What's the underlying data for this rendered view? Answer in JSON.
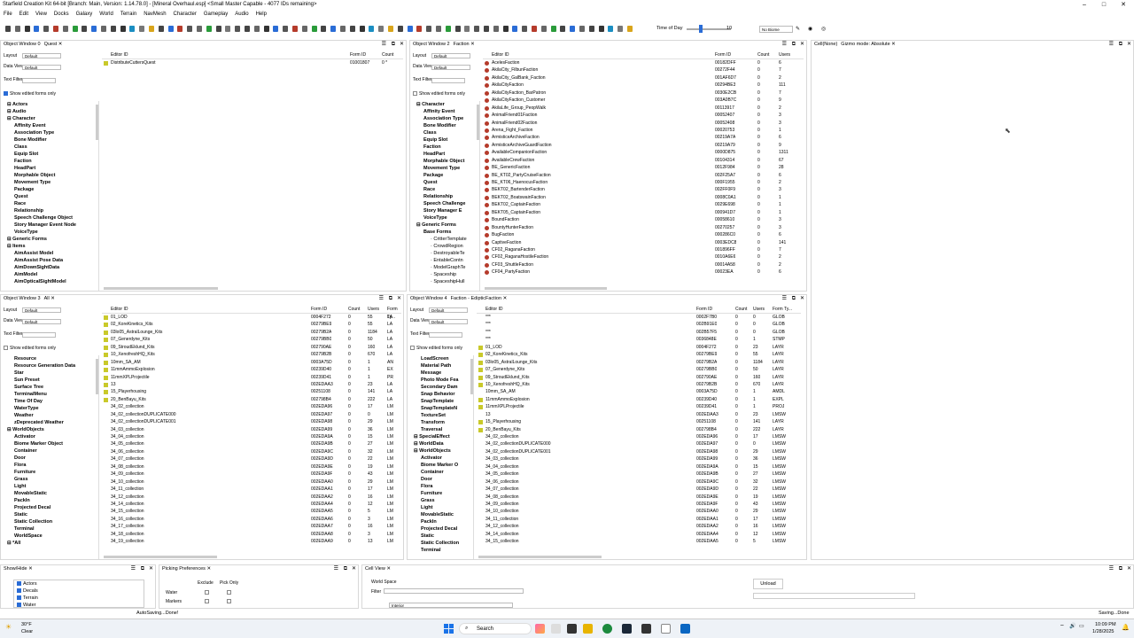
{
  "app": {
    "title": "Starfield Creation Kit 64-bit [Branch: Main, Version: 1.14.78.0] - [Mineral Overhaul.esp] <Small Master Capable - 4077 IDs remaining>"
  },
  "menu": [
    "File",
    "Edit",
    "View",
    "Docks",
    "Galaxy",
    "World",
    "Terrain",
    "NavMesh",
    "Character",
    "Gameplay",
    "Audio",
    "Help"
  ],
  "toolbar": {
    "time_label": "Time of Day",
    "time_value": "10",
    "biome": "No Biome"
  },
  "cell_window": {
    "title": "Cell(None)",
    "gizmo": "Gizmo mode: Absolute"
  },
  "common": {
    "layout": "Layout",
    "data_view": "Data View",
    "text_filter": "Text Filter",
    "default": "Default",
    "show_edited": "Show edited forms only",
    "editor_id": "Editor ID",
    "form_id": "Form ID",
    "count": "Count",
    "users": "Users",
    "form_type": "Form Ty..."
  },
  "ow0": {
    "title": "Object Window 0",
    "tab": "Quest",
    "tree": [
      [
        "Actors",
        0,
        1
      ],
      [
        "Audio",
        0,
        1
      ],
      [
        "Character",
        0,
        1
      ],
      [
        "Affinity Event",
        1,
        1
      ],
      [
        "Association Type",
        1,
        1
      ],
      [
        "Bone Modifier",
        1,
        1
      ],
      [
        "Class",
        1,
        1
      ],
      [
        "Equip Slot",
        1,
        1
      ],
      [
        "Faction",
        1,
        1
      ],
      [
        "HeadPart",
        1,
        1
      ],
      [
        "Morphable Object",
        1,
        1
      ],
      [
        "Movement Type",
        1,
        1
      ],
      [
        "Package",
        1,
        1
      ],
      [
        "Quest",
        1,
        1
      ],
      [
        "Race",
        1,
        1
      ],
      [
        "Relationship",
        1,
        1
      ],
      [
        "Speech Challenge Object",
        1,
        1
      ],
      [
        "Story Manager Event Node",
        1,
        1
      ],
      [
        "VoiceType",
        1,
        1
      ],
      [
        "Generic Forms",
        0,
        1
      ],
      [
        "Items",
        0,
        1
      ],
      [
        "AimAssist Model",
        1,
        1
      ],
      [
        "AimAssist Pose Data",
        1,
        1
      ],
      [
        "AimDownSightData",
        1,
        1
      ],
      [
        "AimModel",
        1,
        1
      ],
      [
        "AimOpticalSightModel",
        1,
        1
      ]
    ],
    "rows": [
      [
        "DistributeCuttersQuest",
        "01001807",
        "0 *"
      ]
    ]
  },
  "ow2": {
    "title": "Object Window 2",
    "tab": "Faction",
    "tree": [
      [
        "Character",
        0,
        1
      ],
      [
        "Affinity Event",
        1,
        1
      ],
      [
        "Association Type",
        1,
        1
      ],
      [
        "Bone Modifier",
        1,
        1
      ],
      [
        "Class",
        1,
        1
      ],
      [
        "Equip Slot",
        1,
        1
      ],
      [
        "Faction",
        1,
        1
      ],
      [
        "HeadPart",
        1,
        1
      ],
      [
        "Morphable Object",
        1,
        1
      ],
      [
        "Movement Type",
        1,
        1
      ],
      [
        "Package",
        1,
        1
      ],
      [
        "Quest",
        1,
        1
      ],
      [
        "Race",
        1,
        1
      ],
      [
        "Relationship",
        1,
        1
      ],
      [
        "Speech Challenge",
        1,
        1
      ],
      [
        "Story Manager E",
        1,
        1
      ],
      [
        "VoiceType",
        1,
        1
      ],
      [
        "Generic Forms",
        0,
        1
      ],
      [
        "Base Forms",
        1,
        1
      ],
      [
        "CritterTemplate",
        2,
        0
      ],
      [
        "CrowdRegion",
        2,
        0
      ],
      [
        "DestroyableTe",
        2,
        0
      ],
      [
        "EntableContn",
        2,
        0
      ],
      [
        "ModelGraphTe",
        2,
        0
      ],
      [
        "Spaceship",
        2,
        0
      ],
      [
        "SpaceshipHull",
        2,
        0
      ]
    ],
    "rows": [
      [
        "AcelesFaction",
        "00182DFF",
        "0",
        "6"
      ],
      [
        "AkilaCity_FilbunFaction",
        "00272F44",
        "0",
        "7"
      ],
      [
        "AkilaCity_GalBank_Faction",
        "001AF6D7",
        "0",
        "2"
      ],
      [
        "AkilaCityFaction",
        "00294BE3",
        "0",
        "111"
      ],
      [
        "AkilaCityFaction_BarPatron",
        "0030E2CB",
        "0",
        "7"
      ],
      [
        "AkilaCityFaction_Customer",
        "003A0B7C",
        "0",
        "9"
      ],
      [
        "AkilaLife_Group_PeopWalk",
        "00113917",
        "0",
        "2"
      ],
      [
        "AnimalFriend01Faction",
        "00052407",
        "0",
        "3"
      ],
      [
        "AnimalFriend02Faction",
        "00052408",
        "0",
        "3"
      ],
      [
        "Arena_Fight_Faction",
        "00020753",
        "0",
        "1"
      ],
      [
        "ArmisticeArchiveFaction",
        "00219A7A",
        "0",
        "6"
      ],
      [
        "ArmisticeArchiveGuardFaction",
        "00219A79",
        "0",
        "9"
      ],
      [
        "AvailableCompanionFaction",
        "0000D875",
        "0",
        "1311"
      ],
      [
        "AvailableCrewFaction",
        "00104314",
        "0",
        "67"
      ],
      [
        "BE_GenericFaction",
        "0012F984",
        "0",
        "28"
      ],
      [
        "BE_KT02_PartyCruiseFaction",
        "002F25A7",
        "0",
        "6"
      ],
      [
        "BE_KT06_HaenocusFaction",
        "000F1955",
        "0",
        "2"
      ],
      [
        "BEKT02_BartenderFaction",
        "002FF0F9",
        "0",
        "3"
      ],
      [
        "BEKT02_BoatswainFaction",
        "0008C0A1",
        "0",
        "1"
      ],
      [
        "BEKT02_CaptainFaction",
        "0029E698",
        "0",
        "1"
      ],
      [
        "BEKT05_CaptainFaction",
        "000941D7",
        "0",
        "1"
      ],
      [
        "BoundFaction",
        "00058610",
        "0",
        "3"
      ],
      [
        "BountyHunterFaction",
        "00270257",
        "0",
        "3"
      ],
      [
        "BugFaction",
        "000286C0",
        "0",
        "6"
      ],
      [
        "CaptiveFaction",
        "0003EDC8",
        "0",
        "141"
      ],
      [
        "CF02_RaganaFaction",
        "001896FF",
        "0",
        "7"
      ],
      [
        "CF02_RaganaHostileFaction",
        "0010A6E6",
        "0",
        "2"
      ],
      [
        "CF03_ShuttleFaction",
        "00014A58",
        "0",
        "2"
      ],
      [
        "CF04_PartyFaction",
        "00023EA",
        "0",
        "6"
      ]
    ]
  },
  "ow3": {
    "title": "Object Window 3",
    "tab": "All",
    "tree": [
      [
        "Resource",
        1,
        1
      ],
      [
        "Resource Generation Data",
        1,
        1
      ],
      [
        "Star",
        1,
        1
      ],
      [
        "Sun Preset",
        1,
        1
      ],
      [
        "Surface Tree",
        1,
        1
      ],
      [
        "TerminalMenu",
        1,
        1
      ],
      [
        "Time Of Day",
        1,
        1
      ],
      [
        "WaterType",
        1,
        1
      ],
      [
        "Weather",
        1,
        1
      ],
      [
        "zDeprecated Weather",
        1,
        1
      ],
      [
        "WorldObjects",
        0,
        1
      ],
      [
        "Activator",
        1,
        1
      ],
      [
        "Biome Marker Object",
        1,
        1
      ],
      [
        "Container",
        1,
        1
      ],
      [
        "Door",
        1,
        1
      ],
      [
        "Flora",
        1,
        1
      ],
      [
        "Furniture",
        1,
        1
      ],
      [
        "Grass",
        1,
        1
      ],
      [
        "Light",
        1,
        1
      ],
      [
        "MovableStatic",
        1,
        1
      ],
      [
        "PackIn",
        1,
        1
      ],
      [
        "Projected Decal",
        1,
        1
      ],
      [
        "Static",
        1,
        1
      ],
      [
        "Static Collection",
        1,
        1
      ],
      [
        "Terminal",
        1,
        1
      ],
      [
        "WorldSpace",
        1,
        1
      ],
      [
        "*All",
        0,
        1
      ]
    ],
    "rows": [
      [
        "01_LOD",
        "0004F272",
        "0",
        "55",
        "LA"
      ],
      [
        "02_KoreKinetics_Kits",
        "00279BE9",
        "0",
        "55",
        "LA"
      ],
      [
        "03lo05_AstralLounge_Kits",
        "00279B2A",
        "0",
        "1184",
        "LA"
      ],
      [
        "07_Generdyne_Kits",
        "00279BB0",
        "0",
        "50",
        "LA"
      ],
      [
        "09_StroudEklund_Kits",
        "002790AE",
        "0",
        "160",
        "LA"
      ],
      [
        "10_XenofreshHQ_Kits",
        "00279B2B",
        "0",
        "670",
        "LA"
      ],
      [
        "10mm_SA_AM",
        "0003A75D",
        "0",
        "1",
        "AN"
      ],
      [
        "11mmAmmoExplosion",
        "00239D40",
        "0",
        "1",
        "EX"
      ],
      [
        "11mmXPLProjectile",
        "00239D41",
        "0",
        "1",
        "PR"
      ],
      [
        "13",
        "002EDAA3",
        "0",
        "23",
        "LA"
      ],
      [
        "15_Playerhousing",
        "00251108",
        "0",
        "141",
        "LA"
      ],
      [
        "20_BenBayu_Kits",
        "002798B4",
        "0",
        "222",
        "LA"
      ],
      [
        "34_02_collection",
        "002EDA96",
        "0",
        "17",
        "LM"
      ],
      [
        "34_02_collectionDUPLICATE000",
        "002EDA97",
        "0",
        "0",
        "LM"
      ],
      [
        "34_02_collectionDUPLICATE001",
        "002EDA98",
        "0",
        "29",
        "LM"
      ],
      [
        "34_03_collection",
        "002EDA99",
        "0",
        "36",
        "LM"
      ],
      [
        "34_04_collection",
        "002EDA9A",
        "0",
        "15",
        "LM"
      ],
      [
        "34_05_collection",
        "002EDA9B",
        "0",
        "27",
        "LM"
      ],
      [
        "34_06_collection",
        "002EDA9C",
        "0",
        "32",
        "LM"
      ],
      [
        "34_07_collection",
        "002EDA9D",
        "0",
        "22",
        "LM"
      ],
      [
        "34_08_collection",
        "002EDA9E",
        "0",
        "19",
        "LM"
      ],
      [
        "34_09_collection",
        "002EDA9F",
        "0",
        "43",
        "LM"
      ],
      [
        "34_10_collection",
        "002EDAA0",
        "0",
        "29",
        "LM"
      ],
      [
        "34_11_collection",
        "002EDAA1",
        "0",
        "17",
        "LM"
      ],
      [
        "34_12_collection",
        "002EDAA2",
        "0",
        "16",
        "LM"
      ],
      [
        "34_14_collection",
        "002EDAA4",
        "0",
        "12",
        "LM"
      ],
      [
        "34_15_collection",
        "002EDAA5",
        "0",
        "5",
        "LM"
      ],
      [
        "34_16_collection",
        "002EDAA6",
        "0",
        "3",
        "LM"
      ],
      [
        "34_17_collection",
        "002EDAA7",
        "0",
        "16",
        "LM"
      ],
      [
        "34_18_collection",
        "002EDAA8",
        "0",
        "3",
        "LM"
      ],
      [
        "34_19_collection",
        "002EDAA9",
        "0",
        "13",
        "LM"
      ]
    ]
  },
  "ow4": {
    "title": "Object Window 4",
    "tab": "Faction - EdipticFaction",
    "tree": [
      [
        "LoadScreen",
        1,
        1
      ],
      [
        "Material Path",
        1,
        1
      ],
      [
        "Message",
        1,
        1
      ],
      [
        "Photo Mode Fea",
        1,
        1
      ],
      [
        "Secondary Dam",
        1,
        1
      ],
      [
        "Snap Behavior",
        1,
        1
      ],
      [
        "SnapTemplate",
        1,
        1
      ],
      [
        "SnapTemplateN",
        1,
        1
      ],
      [
        "TextureSet",
        1,
        1
      ],
      [
        "Transform",
        1,
        1
      ],
      [
        "Traversal",
        1,
        1
      ],
      [
        "SpecialEffect",
        0,
        1
      ],
      [
        "WorldData",
        0,
        1
      ],
      [
        "WorldObjects",
        0,
        1
      ],
      [
        "Activator",
        1,
        1
      ],
      [
        "Biome Marker O",
        1,
        1
      ],
      [
        "Container",
        1,
        1
      ],
      [
        "Door",
        1,
        1
      ],
      [
        "Flora",
        1,
        1
      ],
      [
        "Furniture",
        1,
        1
      ],
      [
        "Grass",
        1,
        1
      ],
      [
        "Light",
        1,
        1
      ],
      [
        "MovableStatic",
        1,
        1
      ],
      [
        "PackIn",
        1,
        1
      ],
      [
        "Projected Decal",
        1,
        1
      ],
      [
        "Static",
        1,
        1
      ],
      [
        "Static Collection",
        1,
        1
      ],
      [
        "Terminal",
        1,
        1
      ]
    ],
    "rows": [
      [
        "***",
        "0002F7B0",
        "0",
        "0",
        "GLOB"
      ],
      [
        "***",
        "002B91E0",
        "0",
        "0",
        "GLOB"
      ],
      [
        "***",
        "002B57F5",
        "0",
        "0",
        "GLOB"
      ],
      [
        "***",
        "0036848E",
        "0",
        "1",
        "STMP"
      ],
      [
        "01_LOD",
        "0004F272",
        "0",
        "23",
        "LAYR"
      ],
      [
        "02_KoreKinetics_Kits",
        "00279BE9",
        "0",
        "55",
        "LAYR"
      ],
      [
        "03lo05_AstralLounge_Kits",
        "00279B2A",
        "0",
        "1184",
        "LAYR"
      ],
      [
        "07_Generdyne_Kits",
        "00279BB0",
        "0",
        "50",
        "LAYR"
      ],
      [
        "09_StroudEklund_Kits",
        "002790AE",
        "0",
        "160",
        "LAYR"
      ],
      [
        "10_XenofreshHQ_Kits",
        "00279B2B",
        "0",
        "670",
        "LAYR"
      ],
      [
        "10mm_SA_AM",
        "0003A75D",
        "0",
        "1",
        "AMDL"
      ],
      [
        "11mmAmmoExplosion",
        "00239D40",
        "0",
        "1",
        "EXPL"
      ],
      [
        "11mmXPLProjectile",
        "00239D41",
        "0",
        "1",
        "PROJ"
      ],
      [
        "13",
        "002EDAA3",
        "0",
        "23",
        "LMSW"
      ],
      [
        "15_Playerhousing",
        "00251108",
        "0",
        "141",
        "LAYR"
      ],
      [
        "20_BenBayu_Kits",
        "002798B4",
        "0",
        "222",
        "LAYR"
      ],
      [
        "34_02_collection",
        "002EDA96",
        "0",
        "17",
        "LMSW"
      ],
      [
        "34_02_collectionDUPLICATE000",
        "002EDA97",
        "0",
        "0",
        "LMSW"
      ],
      [
        "34_02_collectionDUPLICATE001",
        "002EDA98",
        "0",
        "29",
        "LMSW"
      ],
      [
        "34_03_collection",
        "002EDA99",
        "0",
        "36",
        "LMSW"
      ],
      [
        "34_04_collection",
        "002EDA9A",
        "0",
        "15",
        "LMSW"
      ],
      [
        "34_05_collection",
        "002EDA9B",
        "0",
        "27",
        "LMSW"
      ],
      [
        "34_06_collection",
        "002EDA9C",
        "0",
        "32",
        "LMSW"
      ],
      [
        "34_07_collection",
        "002EDA9D",
        "0",
        "22",
        "LMSW"
      ],
      [
        "34_08_collection",
        "002EDA9E",
        "0",
        "19",
        "LMSW"
      ],
      [
        "34_09_collection",
        "002EDA9F",
        "0",
        "43",
        "LMSW"
      ],
      [
        "34_10_collection",
        "002EDAA0",
        "0",
        "29",
        "LMSW"
      ],
      [
        "34_11_collection",
        "002EDAA1",
        "0",
        "17",
        "LMSW"
      ],
      [
        "34_12_collection",
        "002EDAA2",
        "0",
        "16",
        "LMSW"
      ],
      [
        "34_14_collection",
        "002EDAA4",
        "0",
        "12",
        "LMSW"
      ],
      [
        "34_15_collection",
        "002EDAA5",
        "0",
        "5",
        "LMSW"
      ]
    ]
  },
  "showhide": {
    "title": "Show/Hide",
    "items": [
      "Actors",
      "Decals",
      "Terrain",
      "Water"
    ]
  },
  "picking": {
    "title": "Picking Preferences",
    "exclude": "Exclude",
    "pick_only": "Pick Only",
    "rows": [
      "Water",
      "Markers"
    ]
  },
  "cellview": {
    "title": "Cell View",
    "world_space": "World Space",
    "filter": "Filter",
    "interior": "Interior"
  },
  "unload": "Unload",
  "status": {
    "left": "AutoSaving...Done!",
    "right": "Saving...Done"
  },
  "taskbar": {
    "temp": "30°F",
    "weather": "Clear",
    "search": "Search",
    "time": "10:09 PM",
    "date": "1/28/2025"
  }
}
